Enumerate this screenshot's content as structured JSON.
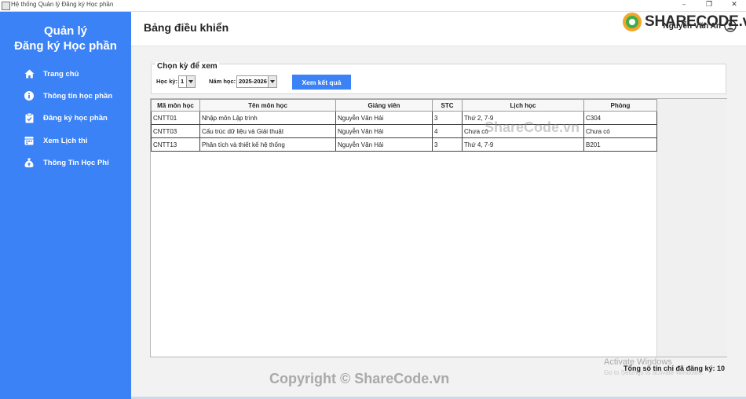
{
  "window": {
    "title": "Hệ thống Quản lý Đăng ký Học phần",
    "minimize_icon": "minimize-icon",
    "maximize_icon": "restore-icon",
    "close_icon": "close-icon"
  },
  "sidebar": {
    "brand_line1": "Quản lý",
    "brand_line2": "Đăng ký Học phần",
    "bg_color": "#3b82f6",
    "items": [
      {
        "label": "Trang chủ",
        "icon": "home-icon"
      },
      {
        "label": "Thông tin học phần",
        "icon": "info-icon"
      },
      {
        "label": "Đăng ký học phần",
        "icon": "register-icon"
      },
      {
        "label": "Xem Lịch thi",
        "icon": "calendar-icon"
      },
      {
        "label": "Thông Tin Học Phí",
        "icon": "money-bag-icon"
      }
    ]
  },
  "header": {
    "title": "Bảng điều khiển",
    "user_name": "Nguyễn Văn An",
    "user_icon": "user-avatar-icon"
  },
  "watermark": {
    "logo_text": "SHARECODE.vn",
    "center_text": "ShareCode.vn",
    "bottom_text": "Copyright © ShareCode.vn"
  },
  "filter": {
    "title": "Chọn kỳ để xem",
    "semester_label": "Học kỳ:",
    "semester_value": "1",
    "year_label": "Năm học:",
    "year_value": "2025-2026",
    "submit_label": "Xem kết quả",
    "accent_color": "#3b82f6"
  },
  "table": {
    "columns": [
      "Mã môn học",
      "Tên môn học",
      "Giảng viên",
      "STC",
      "Lịch học",
      "Phòng"
    ],
    "rows": [
      [
        "CNTT01",
        "Nhập môn Lập trình",
        "Nguyễn Văn Hải",
        "3",
        "Thứ 2, 7-9",
        "C304"
      ],
      [
        "CNTT03",
        "Cấu trúc dữ liệu và Giải thuật",
        "Nguyễn Văn Hải",
        "4",
        "Chưa có",
        "Chưa có"
      ],
      [
        "CNTT13",
        "Phân tích và thiết kế hệ thống",
        "Nguyễn Văn Hải",
        "3",
        "Thứ 4, 7-9",
        "B201"
      ]
    ]
  },
  "summary": {
    "total_credits": "Tổng số tín chỉ đã đăng ký: 10"
  },
  "os_overlay": {
    "line1": "Activate Windows",
    "line2": "Go to Settings to activate Windows."
  }
}
